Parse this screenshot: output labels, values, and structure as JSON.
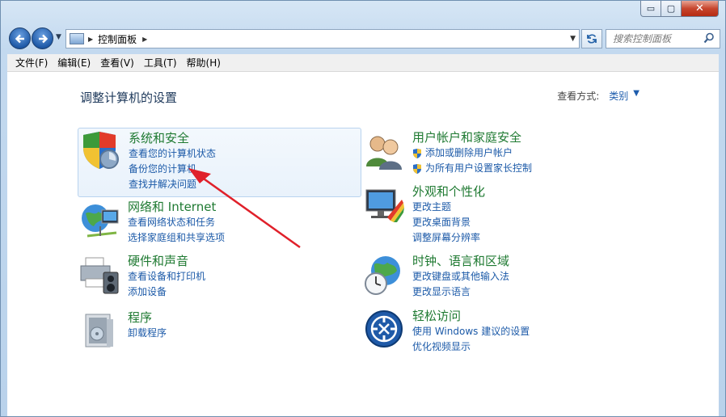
{
  "window": {
    "minimize_glyph": "▭",
    "maximize_glyph": "▢",
    "close_glyph": "✕"
  },
  "address": {
    "path": "控制面板"
  },
  "search": {
    "placeholder": "搜索控制面板"
  },
  "menu": [
    "文件(F)",
    "编辑(E)",
    "查看(V)",
    "工具(T)",
    "帮助(H)"
  ],
  "page": {
    "title": "调整计算机的设置",
    "viewby_label": "查看方式:",
    "viewby_value": "类别"
  },
  "categories": {
    "system_security": {
      "title": "系统和安全",
      "links": [
        "查看您的计算机状态",
        "备份您的计算机",
        "查找并解决问题"
      ]
    },
    "user_accounts": {
      "title": "用户帐户和家庭安全",
      "links": [
        "添加或删除用户帐户",
        "为所有用户设置家长控制"
      ]
    },
    "network": {
      "title": "网络和 Internet",
      "links": [
        "查看网络状态和任务",
        "选择家庭组和共享选项"
      ]
    },
    "appearance": {
      "title": "外观和个性化",
      "links": [
        "更改主题",
        "更改桌面背景",
        "调整屏幕分辨率"
      ]
    },
    "hardware": {
      "title": "硬件和声音",
      "links": [
        "查看设备和打印机",
        "添加设备"
      ]
    },
    "clock": {
      "title": "时钟、语言和区域",
      "links": [
        "更改键盘或其他输入法",
        "更改显示语言"
      ]
    },
    "programs": {
      "title": "程序",
      "links": [
        "卸载程序"
      ]
    },
    "ease": {
      "title": "轻松访问",
      "links": [
        "使用 Windows 建议的设置",
        "优化视频显示"
      ]
    }
  },
  "colors": {
    "category_title": "#1f7a32",
    "link": "#1c5aa8",
    "annotation_arrow": "#e0202a"
  }
}
